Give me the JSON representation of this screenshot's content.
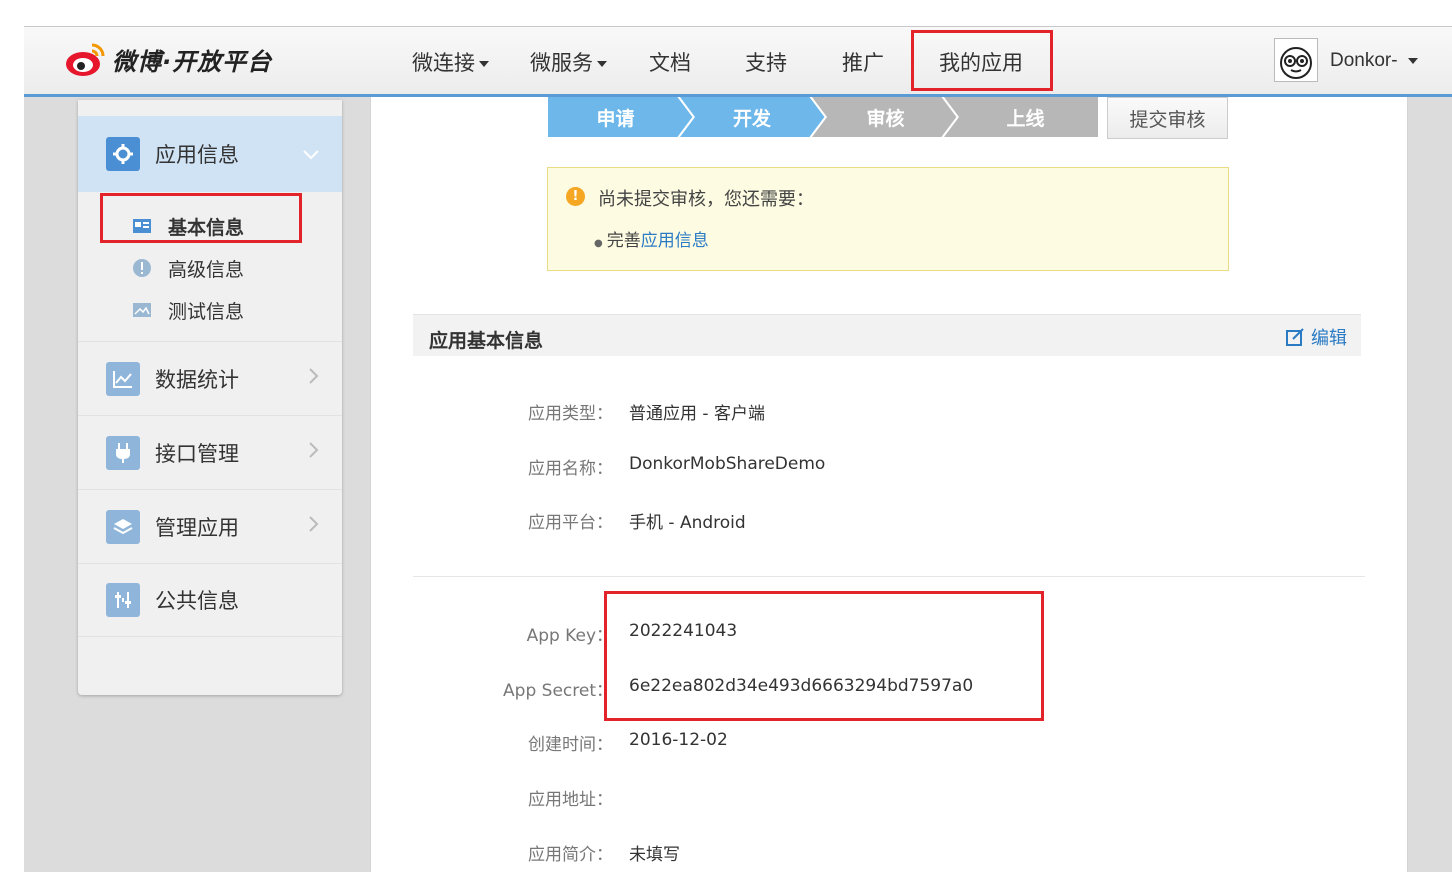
{
  "header": {
    "logo_text": "微博·开放平台",
    "nav": [
      {
        "label": "微连接",
        "has_dropdown": true
      },
      {
        "label": "微服务",
        "has_dropdown": true
      },
      {
        "label": "文档",
        "has_dropdown": false
      },
      {
        "label": "支持",
        "has_dropdown": false
      },
      {
        "label": "推广",
        "has_dropdown": false
      },
      {
        "label": "我的应用",
        "has_dropdown": false,
        "highlighted": true
      }
    ],
    "user_name": "Donkor-"
  },
  "sidebar": {
    "active_section": {
      "label": "应用信息",
      "icon": "gear-icon"
    },
    "sub_items": [
      {
        "label": "基本信息",
        "icon": "id-card-icon",
        "highlighted": true
      },
      {
        "label": "高级信息",
        "icon": "exclamation-icon"
      },
      {
        "label": "测试信息",
        "icon": "image-icon"
      }
    ],
    "sections": [
      {
        "label": "数据统计",
        "icon": "line-chart-icon"
      },
      {
        "label": "接口管理",
        "icon": "plug-icon"
      },
      {
        "label": "管理应用",
        "icon": "layers-icon"
      },
      {
        "label": "公共信息",
        "icon": "sliders-icon"
      }
    ]
  },
  "progress": {
    "steps": [
      "申请",
      "开发",
      "审核",
      "上线"
    ],
    "completed_steps": 2,
    "submit_label": "提交审核"
  },
  "notice": {
    "message": "尚未提交审核，您还需要：",
    "item_prefix": "完善",
    "item_link": "应用信息"
  },
  "basic_info": {
    "title": "应用基本信息",
    "edit_label": "编辑",
    "rows": [
      {
        "label": "应用类型：",
        "value": "普通应用 - 客户端"
      },
      {
        "label": "应用名称：",
        "value": "DonkorMobShareDemo"
      },
      {
        "label": "应用平台：",
        "value": "手机 - Android"
      }
    ],
    "key_rows": [
      {
        "label": "App Key：",
        "value": "2022241043"
      },
      {
        "label": "App Secret：",
        "value": "6e22ea802d34e493d6663294bd7597a0"
      }
    ],
    "more_rows": [
      {
        "label": "创建时间：",
        "value": "2016-12-02"
      },
      {
        "label": "应用地址：",
        "value": ""
      },
      {
        "label": "应用简介：",
        "value": "未填写"
      }
    ]
  },
  "colors": {
    "accent_blue": "#5b9bd5",
    "step_active": "#6db7ea",
    "step_inactive": "#b7b7b7",
    "highlight_red": "#e3232a",
    "link": "#2a7bc4"
  }
}
